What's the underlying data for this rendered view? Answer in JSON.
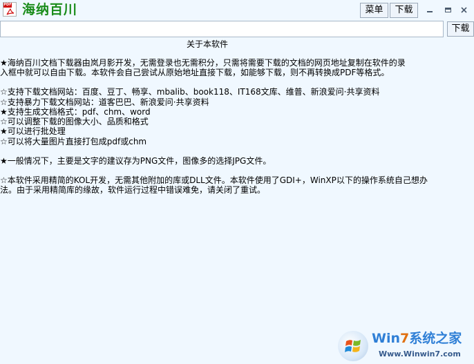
{
  "window": {
    "title": "海纳百川",
    "icon_tag": "PDF",
    "menu_label": "菜单",
    "download_label": "下载"
  },
  "url_bar": {
    "value": "",
    "go_label": "下载"
  },
  "content": {
    "heading": "关于本软件",
    "lines": [
      "★海纳百川文档下载器由岚月影开发，无需登录也无需积分，只需将需要下载的文档的网页地址复制在软件的录",
      "入框中就可以自由下载。本软件会自己尝试从原始地址直接下载，如能够下载，则不再转换成PDF等格式。",
      "☆支持下载文档网站：百度、豆丁、畅享、mbalib、book118、IT168文库、维普、新浪爱问·共享资料",
      "☆支持暴力下载文档网站：道客巴巴、新浪爱问·共享资料",
      "★支持生成文档格式：pdf、chm、word",
      "☆可以调整下载的图像大小、品质和格式",
      "★可以进行批处理",
      "☆可以将大量图片直接打包成pdf或chm",
      "★一般情况下，主要是文字的建议存为PNG文件，图像多的选择JPG文件。",
      "☆本软件采用精简的KOL开发，无需其他附加的库或DLL文件。本软件使用了GDI+，WinXP以下的操作系统自己想办",
      "法。由于采用精简库的缘故，软件运行过程中错误难免，请关闭了重试。"
    ]
  },
  "watermark": {
    "brand_part1": "Win",
    "brand_part2": "7",
    "brand_part3": "系统之家",
    "url": "Www.Winwin7.com"
  }
}
